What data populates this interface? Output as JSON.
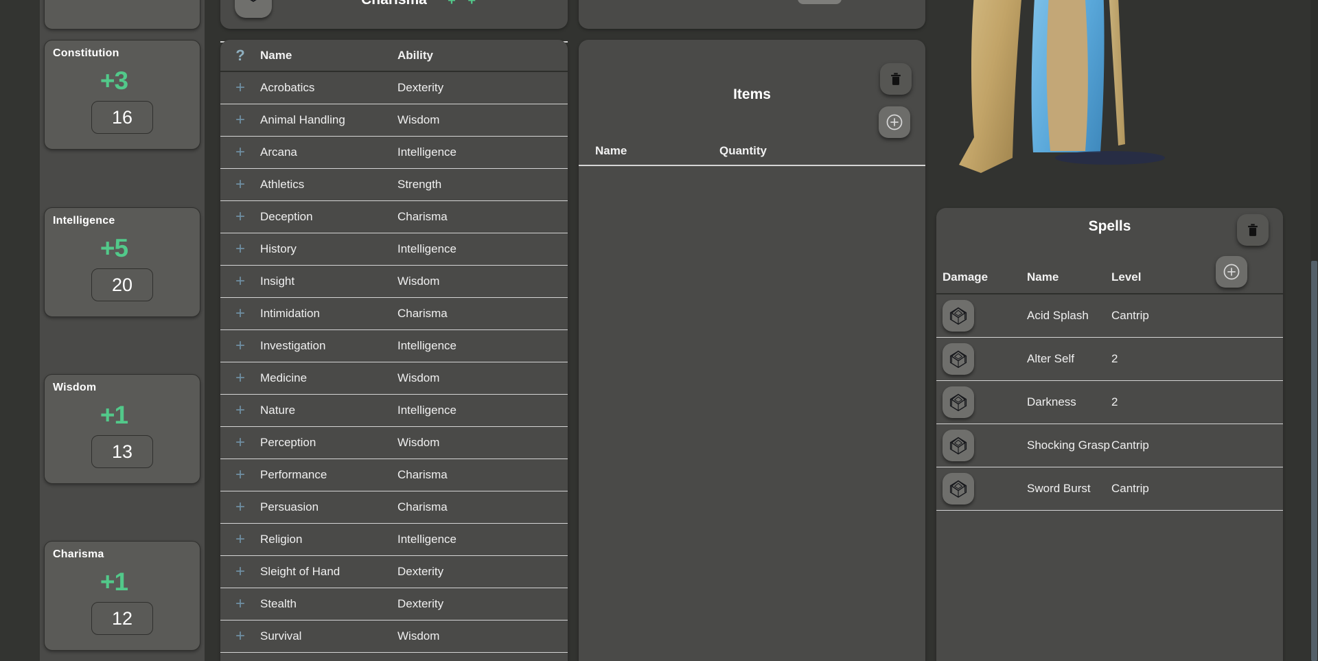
{
  "theme": {
    "page_bg": "#323330",
    "panel_bg": "#4a4a48",
    "card_bg": "#5a5a57",
    "accent_green": "#52c98a",
    "plus_blue": "#6f8fa3",
    "text": "#f2f2f2",
    "scrollbar": "#546069"
  },
  "abilities": {
    "cards": [
      {
        "name": "Constitution",
        "modifier": "+3",
        "score": "16"
      },
      {
        "name": "Intelligence",
        "modifier": "+5",
        "score": "20"
      },
      {
        "name": "Wisdom",
        "modifier": "+1",
        "score": "13"
      },
      {
        "name": "Charisma",
        "modifier": "+1",
        "score": "12"
      }
    ]
  },
  "partial_top_panel": {
    "title": "Charisma",
    "plus_marks": "+ +",
    "dice_icon": "d20-dice-icon"
  },
  "skills": {
    "columns": {
      "check": "?",
      "name": "Name",
      "ability": "Ability"
    },
    "rows": [
      {
        "add": "+",
        "name": "Acrobatics",
        "ability": "Dexterity"
      },
      {
        "add": "+",
        "name": "Animal Handling",
        "ability": "Wisdom"
      },
      {
        "add": "+",
        "name": "Arcana",
        "ability": "Intelligence"
      },
      {
        "add": "+",
        "name": "Athletics",
        "ability": "Strength"
      },
      {
        "add": "+",
        "name": "Deception",
        "ability": "Charisma"
      },
      {
        "add": "+",
        "name": "History",
        "ability": "Intelligence"
      },
      {
        "add": "+",
        "name": "Insight",
        "ability": "Wisdom"
      },
      {
        "add": "+",
        "name": "Intimidation",
        "ability": "Charisma"
      },
      {
        "add": "+",
        "name": "Investigation",
        "ability": "Intelligence"
      },
      {
        "add": "+",
        "name": "Medicine",
        "ability": "Wisdom"
      },
      {
        "add": "+",
        "name": "Nature",
        "ability": "Intelligence"
      },
      {
        "add": "+",
        "name": "Perception",
        "ability": "Wisdom"
      },
      {
        "add": "+",
        "name": "Performance",
        "ability": "Charisma"
      },
      {
        "add": "+",
        "name": "Persuasion",
        "ability": "Charisma"
      },
      {
        "add": "+",
        "name": "Religion",
        "ability": "Intelligence"
      },
      {
        "add": "+",
        "name": "Sleight of Hand",
        "ability": "Dexterity"
      },
      {
        "add": "+",
        "name": "Stealth",
        "ability": "Dexterity"
      },
      {
        "add": "+",
        "name": "Survival",
        "ability": "Wisdom"
      }
    ]
  },
  "items": {
    "title": "Items",
    "columns": {
      "name": "Name",
      "quantity": "Quantity"
    },
    "rows": [],
    "delete_icon": "trash-icon",
    "add_icon": "plus-circle-icon"
  },
  "spells": {
    "title": "Spells",
    "columns": {
      "damage": "Damage",
      "name": "Name",
      "level": "Level"
    },
    "delete_icon": "trash-icon",
    "add_icon": "plus-circle-icon",
    "rows": [
      {
        "damage_icon": "d20-dice-icon",
        "name": "Acid Splash",
        "level": "Cantrip"
      },
      {
        "damage_icon": "d20-dice-icon",
        "name": "Alter Self",
        "level": "2"
      },
      {
        "damage_icon": "d20-dice-icon",
        "name": "Darkness",
        "level": "2"
      },
      {
        "damage_icon": "d20-dice-icon",
        "name": "Shocking Grasp",
        "level": "Cantrip"
      },
      {
        "damage_icon": "d20-dice-icon",
        "name": "Sword Burst",
        "level": "Cantrip"
      }
    ]
  },
  "portrait": {
    "alt": "wizard-character-portrait"
  }
}
